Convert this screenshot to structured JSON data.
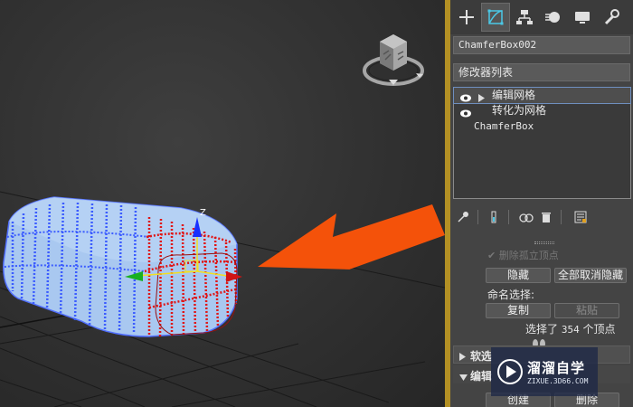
{
  "panel": {
    "tabs": [
      {
        "icon": "create-plus-icon"
      },
      {
        "icon": "modify-icon",
        "active": true
      },
      {
        "icon": "hierarchy-icon"
      },
      {
        "icon": "motion-icon"
      },
      {
        "icon": "display-icon"
      },
      {
        "icon": "utilities-wrench-icon"
      }
    ],
    "object_name": "ChamferBox002",
    "modifier_list_label": "修改器列表",
    "stack": [
      {
        "label": "编辑网格",
        "visible": true,
        "expandable": true,
        "selected": true
      },
      {
        "label": "转化为网格",
        "visible": true,
        "expandable": false,
        "selected": false
      },
      {
        "label": "ChamferBox",
        "base": true
      }
    ],
    "toolbar_icons": [
      "pin-stack-icon",
      "show-end-result-icon",
      "make-unique-icon",
      "remove-modifier-icon",
      "configure-sets-icon"
    ],
    "selection": {
      "faded_option": "删除孤立顶点",
      "hide_label": "隐藏",
      "unhide_all_label": "全部取消隐藏",
      "named_selection_label": "命名选择:",
      "copy_label": "复制",
      "paste_label": "粘贴",
      "selected_prefix": "选择了",
      "selected_count": "354",
      "selected_suffix": "个顶点"
    },
    "rollups": [
      {
        "label": "软选"
      },
      {
        "label": "编辑"
      }
    ],
    "bottom_buttons": {
      "create_label": "创建",
      "delete_label": "删除"
    }
  },
  "viewport": {
    "axis_label": "Z",
    "accent_colors": {
      "arrow": "#f4520a",
      "selected_vertex": "#e01616",
      "vertex": "#3b5cff",
      "object": "#a9c8f0"
    }
  },
  "watermark": {
    "title": "溜溜自学",
    "url": "ZIXUE.3D66.COM"
  }
}
